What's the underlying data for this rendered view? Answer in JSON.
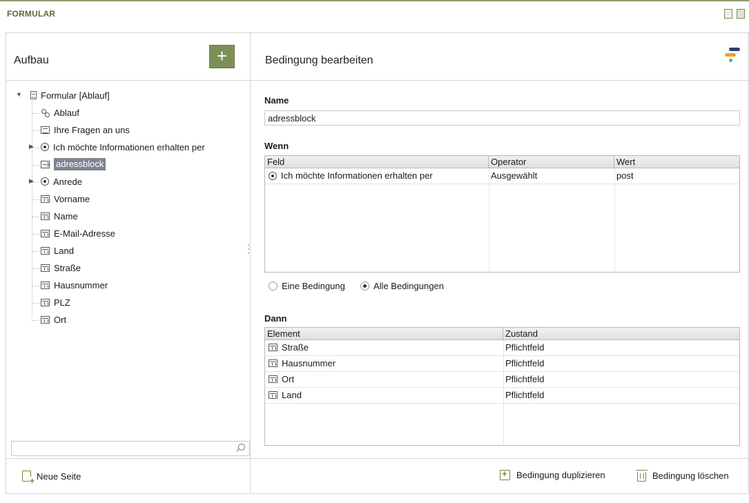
{
  "window": {
    "title": "FORMULAR"
  },
  "left": {
    "header": "Aufbau",
    "add_label": "+",
    "tree": [
      {
        "label": "Formular [Ablauf]",
        "icon": "document-icon",
        "expanded": true
      },
      {
        "label": "Ablauf",
        "icon": "flow-icon"
      },
      {
        "label": "Ihre Fragen an uns",
        "icon": "textarea-icon"
      },
      {
        "label": "Ich möchte Informationen erhalten per",
        "icon": "radio-icon",
        "collapsed": true
      },
      {
        "label": "adressblock",
        "icon": "condition-icon",
        "selected": true
      },
      {
        "label": "Anrede",
        "icon": "radio-icon",
        "collapsed": true
      },
      {
        "label": "Vorname",
        "icon": "textfield-icon"
      },
      {
        "label": "Name",
        "icon": "textfield-icon"
      },
      {
        "label": "E-Mail-Adresse",
        "icon": "textfield-icon"
      },
      {
        "label": "Land",
        "icon": "textfield-icon"
      },
      {
        "label": "Straße",
        "icon": "textfield-icon"
      },
      {
        "label": "Hausnummer",
        "icon": "textfield-icon"
      },
      {
        "label": "PLZ",
        "icon": "textfield-icon"
      },
      {
        "label": "Ort",
        "icon": "textfield-icon"
      }
    ],
    "search": {
      "value": ""
    },
    "new_page_label": "Neue Seite"
  },
  "right": {
    "header": "Bedingung bearbeiten",
    "name_label": "Name",
    "name_value": "adressblock",
    "wenn_label": "Wenn",
    "wenn_columns": [
      "Feld",
      "Operator",
      "Wert"
    ],
    "wenn_rows": [
      {
        "feld": "Ich möchte Informationen erhalten per",
        "operator": "Ausgewählt",
        "wert": "post"
      }
    ],
    "mode": {
      "option1": "Eine Bedingung",
      "option2": "Alle Bedingungen",
      "selected": "Alle Bedingungen"
    },
    "dann_label": "Dann",
    "dann_columns": [
      "Element",
      "Zustand"
    ],
    "dann_rows": [
      {
        "element": "Straße",
        "zustand": "Pflichtfeld"
      },
      {
        "element": "Hausnummer",
        "zustand": "Pflichtfeld"
      },
      {
        "element": "Ort",
        "zustand": "Pflichtfeld"
      },
      {
        "element": "Land",
        "zustand": "Pflichtfeld"
      }
    ],
    "duplicate_label": "Bedingung duplizieren",
    "delete_label": "Bedingung löschen"
  },
  "colors": {
    "accent": "#7c9056",
    "selection": "#7e8591",
    "title": "#5d6a3a"
  }
}
